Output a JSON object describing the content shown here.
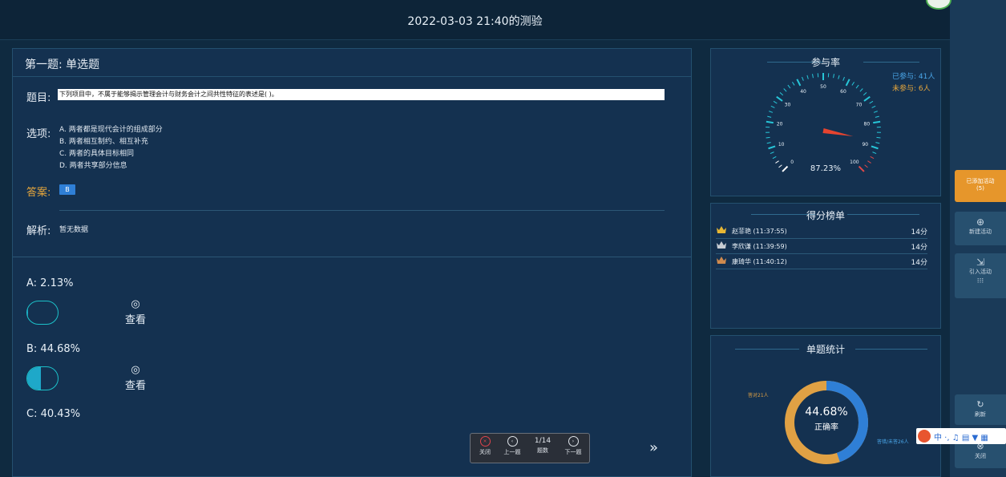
{
  "header": {
    "title": "2022-03-03 21:40的测验"
  },
  "question": {
    "heading": "第一题: 单选题",
    "stem_label": "题目:",
    "stem_text": "下列项目中，不属于能够揭示管理会计与财务会计之间共性特征的表述是( )。",
    "options_label": "选项:",
    "options": [
      "A. 两者都是现代会计的组成部分",
      "B. 两者相互制约、相互补充",
      "C. 两者的具体目标相同",
      "D. 两者共享部分信息"
    ],
    "answer_label": "答案:",
    "answer_value": "B",
    "analysis_label": "解析:",
    "analysis_text": "暂无数据"
  },
  "option_stats": [
    {
      "label": "A: 2.13%",
      "fill": 0.0213,
      "view_label": "查看"
    },
    {
      "label": "B: 44.68%",
      "fill": 0.4468,
      "view_label": "查看"
    },
    {
      "label": "C: 40.43%"
    }
  ],
  "controls": {
    "close": "关闭",
    "prev": "上一题",
    "page": "1/14",
    "page_label": "题数",
    "next": "下一题"
  },
  "participation": {
    "title": "参与率",
    "joined": "已参与: 41人",
    "not_joined": "未参与: 6人",
    "rate_text": "87.23%",
    "rate": 87.23,
    "ticks": [
      "0",
      "10",
      "20",
      "30",
      "40",
      "50",
      "60",
      "70",
      "80",
      "90",
      "100"
    ]
  },
  "leaderboard": {
    "title": "得分榜单",
    "rows": [
      {
        "name": "赵菲艳 (11:37:55)",
        "score": "14分"
      },
      {
        "name": "李欣谦 (11:39:59)",
        "score": "14分"
      },
      {
        "name": "康琦华 (11:40:12)",
        "score": "14分"
      }
    ]
  },
  "single_stats": {
    "title": "单题统计",
    "center_value": "44.68%",
    "center_label": "正确率",
    "correct_label": "答对21人",
    "wrong_label": "答错/未答26人",
    "correct_fraction": 0.4468
  },
  "sidebar": {
    "added_activity": "已添加活动",
    "added_count": "(5)",
    "new_activity": "新建活动",
    "import_activity": "引入活动",
    "refresh": "刷新",
    "close": "关闭"
  },
  "colors": {
    "accent_blue": "#2f7fd6",
    "joined": "#4aa6e8",
    "not_joined": "#e6a63c",
    "donut_correct": "#2f7fd6",
    "donut_wrong": "#e0a144",
    "orange_button": "#e6962b"
  }
}
